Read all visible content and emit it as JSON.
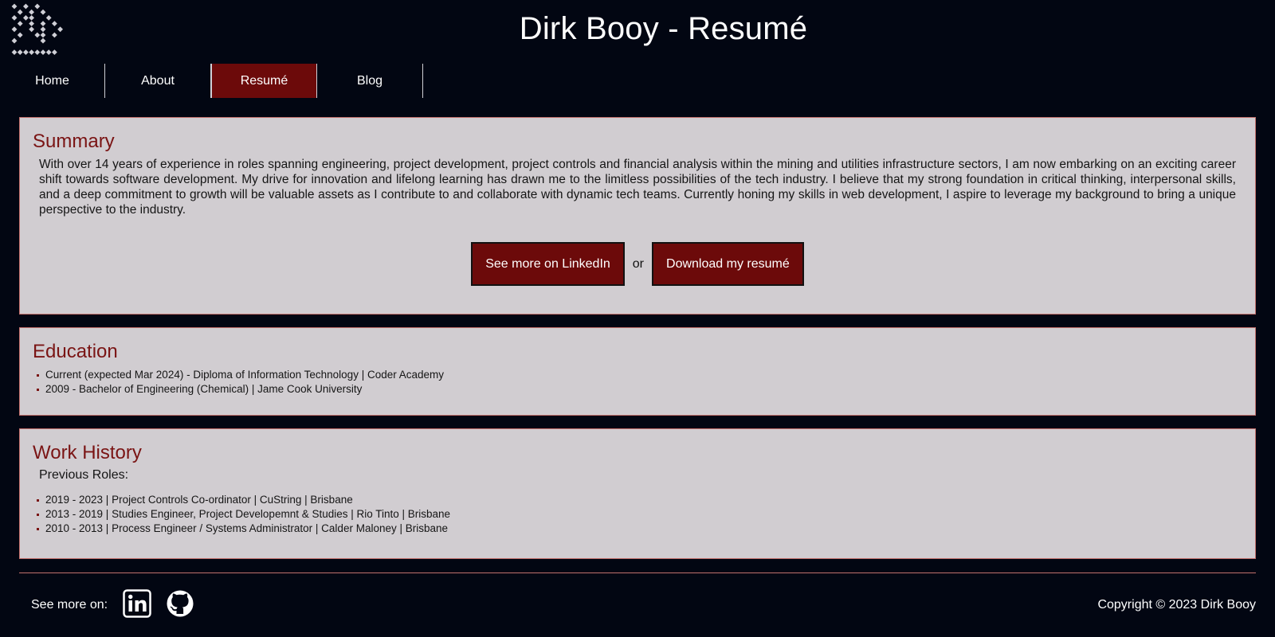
{
  "header": {
    "title": "Dirk Booy - Resumé",
    "logo_icon": "pixel-diamond-logo-icon"
  },
  "nav": {
    "items": [
      {
        "label": "Home",
        "active": false
      },
      {
        "label": "About",
        "active": false
      },
      {
        "label": "Resumé",
        "active": true
      },
      {
        "label": "Blog",
        "active": false
      }
    ]
  },
  "summary": {
    "heading": "Summary",
    "text": "With over 14 years of experience in roles spanning engineering, project development, project controls and financial analysis within the mining and utilities infrastructure sectors, I am now embarking on an exciting career shift towards software development. My drive for innovation and lifelong learning has drawn me to the limitless possibilities of the tech industry. I believe that my strong foundation in critical thinking, interpersonal skills, and a deep commitment to growth will be valuable assets as I contribute to and collaborate with dynamic tech teams. Currently honing my skills in web development, I aspire to leverage my background to bring a unique perspective to the industry.",
    "linkedin_button": "See more on LinkedIn",
    "or_text": "or",
    "download_button": "Download my resumé"
  },
  "education": {
    "heading": "Education",
    "items": [
      "Current (expected Mar 2024) - Diploma of Information Technology | Coder Academy",
      "2009 - Bachelor of Engineering (Chemical) | Jame Cook University"
    ]
  },
  "work": {
    "heading": "Work History",
    "subheading": "Previous Roles:",
    "items": [
      "2019 - 2023 | Project Controls Co-ordinator | CuString | Brisbane",
      "2013 - 2019 | Studies Engineer, Project Developemnt & Studies | Rio Tinto | Brisbane",
      "2010 - 2013 | Process Engineer / Systems Administrator | Calder Maloney | Brisbane"
    ]
  },
  "footer": {
    "see_more": "See more on:",
    "icons": [
      "linkedin-icon",
      "github-icon"
    ],
    "copyright": "Copyright © 2023 Dirk Booy"
  },
  "colors": {
    "background": "#020612",
    "accent": "#6c0a0a",
    "card": "#d1cdd1",
    "heading": "#7a1414"
  }
}
